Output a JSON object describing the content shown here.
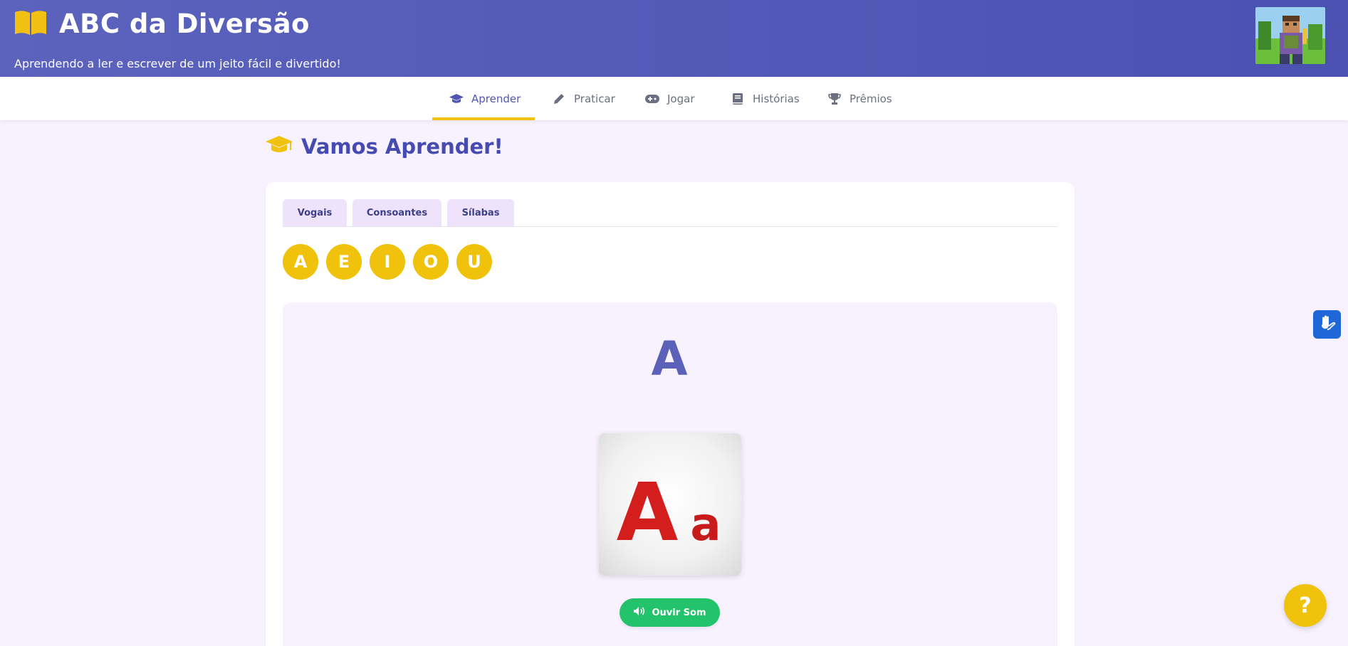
{
  "header": {
    "title": "ABC da Diversão",
    "subtitle": "Aprendendo a ler e escrever de um jeito fácil e divertido!",
    "brand_icon": "open-book-icon",
    "avatar": "player-avatar"
  },
  "nav": {
    "items": [
      {
        "label": "Aprender",
        "icon": "graduation-cap-icon",
        "active": true
      },
      {
        "label": "Praticar",
        "icon": "pencil-icon"
      },
      {
        "label": "Jogar",
        "icon": "gamepad-icon"
      },
      {
        "label": "Histórias",
        "icon": "book-icon"
      },
      {
        "label": "Prêmios",
        "icon": "trophy-icon"
      }
    ]
  },
  "section": {
    "title": "Vamos Aprender!",
    "icon": "graduation-cap-icon"
  },
  "tabs": [
    "Vogais",
    "Consoantes",
    "Sílabas"
  ],
  "vowels": [
    "A",
    "E",
    "I",
    "O",
    "U"
  ],
  "display": {
    "letter": "A",
    "image": {
      "upper": "A",
      "lower": "a"
    },
    "sound_button": "Ouvir Som"
  },
  "help_button": "?",
  "colors": {
    "header": "#5158b8",
    "accent_yellow": "#f0c20c",
    "primary": "#4f56b4",
    "sound_green": "#22c36a",
    "libras_blue": "#1f66d8",
    "letter_red": "#d41e1e"
  }
}
